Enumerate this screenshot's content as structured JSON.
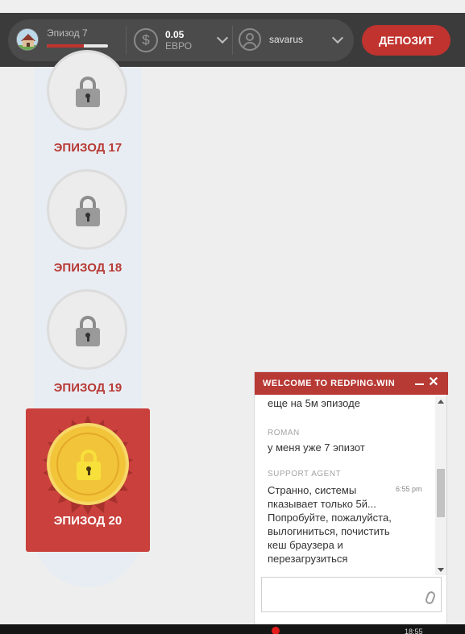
{
  "header": {
    "episode_label": "Эпизод 7",
    "episode_progress": 0.6,
    "balance": "0.05",
    "currency": "ЕВРО",
    "currency_icon": "dollar-coin-icon",
    "username": "savarus",
    "deposit_label": "ДЕПОЗИТ",
    "accent_color": "#c0332f"
  },
  "episodes": [
    {
      "title": "ЭПИЗОД 17",
      "state": "locked"
    },
    {
      "title": "ЭПИЗОД 18",
      "state": "locked"
    },
    {
      "title": "ЭПИЗОД 19",
      "state": "locked"
    },
    {
      "title": "ЭПИЗОД 20",
      "state": "current"
    }
  ],
  "chat": {
    "title": "WELCOME TO REDPING.WIN",
    "cut_message": "еще на 5м эпизоде",
    "messages": [
      {
        "sender": "ROMAN",
        "text": "у меня уже 7 эпизот",
        "time": ""
      },
      {
        "sender": "SUPPORT AGENT",
        "text": "Странно, системы пказывает только 5й... Попробуйте, пожалуйста, вылогиниться, почистить кеш браузера и перезагрузиться",
        "time": "6:55 pm"
      }
    ],
    "input_placeholder": ""
  },
  "taskbar": {
    "time": "18:55"
  }
}
